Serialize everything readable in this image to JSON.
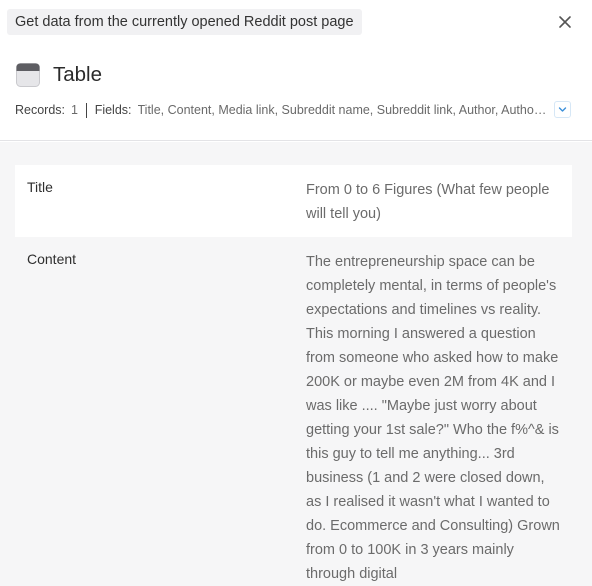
{
  "header": {
    "task_title": "Get data from the currently opened Reddit post page",
    "close_icon": "close-icon"
  },
  "table": {
    "title": "Table",
    "icon": "table-icon",
    "records_label": "Records:",
    "records_count": "1",
    "fields_label": "Fields:",
    "fields_list": "Title, Content, Media link, Subreddit name, Subreddit link, Author, Author link, Upvotes, Comments count",
    "expand_icon": "chevron-down-icon"
  },
  "record": {
    "rows": [
      {
        "name": "Title",
        "value": "From 0 to 6 Figures (What few people will tell you)"
      },
      {
        "name": "Content",
        "value": "The entrepreneurship space can be completely mental, in terms of people's expectations and timelines vs reality. This morning I answered a question from someone who asked how to make 200K or maybe even 2M from 4K and I was like .... \"Maybe just worry about getting your 1st sale?\" Who the f%^& is this guy to tell me anything... 3rd business (1 and 2 were closed down, as I realised it wasn't what I wanted to do. Ecommerce and Consulting) Grown from 0 to 100K in 3 years mainly through digital"
      }
    ]
  },
  "colors": {
    "chip_bg": "#f1f1f3",
    "content_bg": "#f6f6f7",
    "accent": "#3b8fd9"
  }
}
